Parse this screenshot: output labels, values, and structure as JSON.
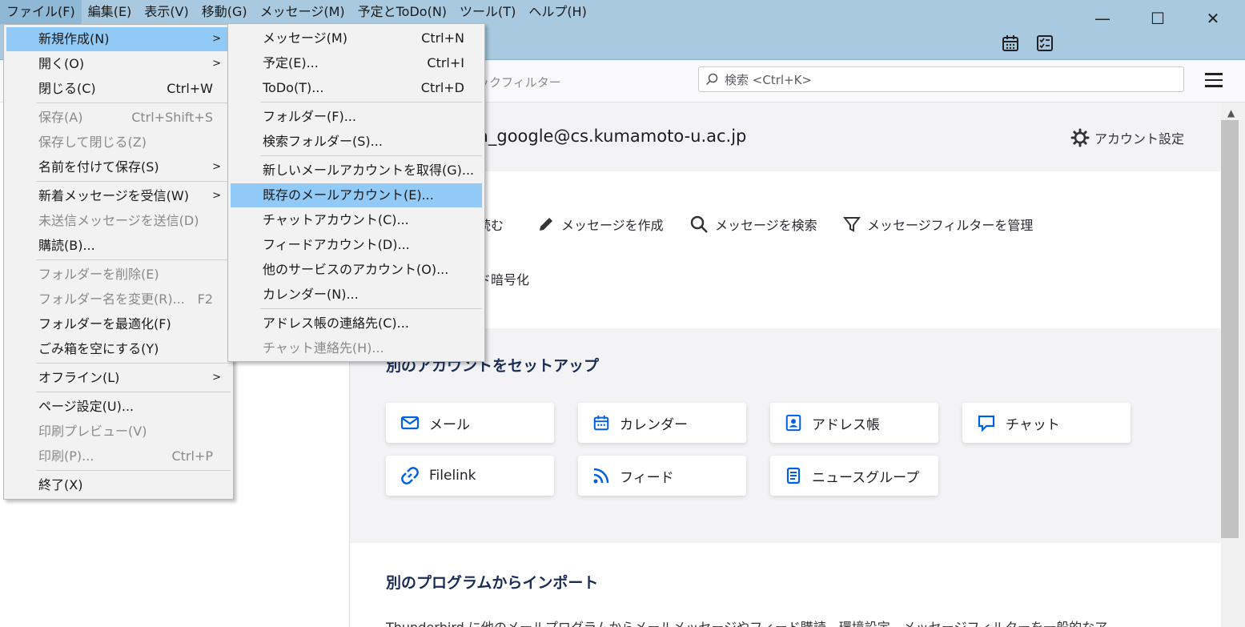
{
  "menubar": {
    "items": [
      "ファイル(F)",
      "編集(E)",
      "表示(V)",
      "移動(G)",
      "メッセージ(M)",
      "予定とToDo(N)",
      "ツール(T)",
      "ヘルプ(H)"
    ]
  },
  "window": {
    "minimize": "—",
    "maximize": "☐",
    "close": "✕"
  },
  "toolbar": {
    "quick_filter": "ックフィルター",
    "search_placeholder": "検索 <Ctrl+K>"
  },
  "account": {
    "email": "a_google@cs.kumamoto-u.ac.jp",
    "settings_label": "アカウント設定"
  },
  "actions": {
    "read": "読む",
    "compose": "メッセージを作成",
    "search": "メッセージを検索",
    "filters": "メッセージフィルターを管理",
    "e2e": "ド暗号化"
  },
  "setup": {
    "title": "別のアカウントをセットアップ",
    "buttons": [
      "メール",
      "カレンダー",
      "アドレス帳",
      "チャット",
      "Filelink",
      "フィード",
      "ニュースグループ"
    ]
  },
  "import": {
    "title": "別のプログラムからインポート",
    "description": "Thunderbird に他のメールプログラムからメールメッセージやフィード購読、環境設定、メッセージフィルターを一般的なア"
  },
  "file_menu": {
    "items": [
      {
        "label": "新規作成(N)",
        "shortcut": "",
        "submenu": true,
        "disabled": false,
        "highlighted": true
      },
      {
        "label": "開く(O)",
        "shortcut": "",
        "submenu": true,
        "disabled": false
      },
      {
        "label": "閉じる(C)",
        "shortcut": "Ctrl+W",
        "submenu": false,
        "disabled": false
      },
      {
        "label": "保存(A)",
        "shortcut": "Ctrl+Shift+S",
        "submenu": false,
        "disabled": true
      },
      {
        "label": "保存して閉じる(Z)",
        "shortcut": "",
        "submenu": false,
        "disabled": true
      },
      {
        "label": "名前を付けて保存(S)",
        "shortcut": "",
        "submenu": true,
        "disabled": false
      },
      {
        "label": "新着メッセージを受信(W)",
        "shortcut": "",
        "submenu": true,
        "disabled": false
      },
      {
        "label": "未送信メッセージを送信(D)",
        "shortcut": "",
        "submenu": false,
        "disabled": true
      },
      {
        "label": "購読(B)...",
        "shortcut": "",
        "submenu": false,
        "disabled": false
      },
      {
        "label": "フォルダーを削除(E)",
        "shortcut": "",
        "submenu": false,
        "disabled": true
      },
      {
        "label": "フォルダー名を変更(R)...",
        "shortcut": "F2",
        "submenu": false,
        "disabled": true
      },
      {
        "label": "フォルダーを最適化(F)",
        "shortcut": "",
        "submenu": false,
        "disabled": false
      },
      {
        "label": "ごみ箱を空にする(Y)",
        "shortcut": "",
        "submenu": false,
        "disabled": false
      },
      {
        "label": "オフライン(L)",
        "shortcut": "",
        "submenu": true,
        "disabled": false
      },
      {
        "label": "ページ設定(U)...",
        "shortcut": "",
        "submenu": false,
        "disabled": false
      },
      {
        "label": "印刷プレビュー(V)",
        "shortcut": "",
        "submenu": false,
        "disabled": true
      },
      {
        "label": "印刷(P)...",
        "shortcut": "Ctrl+P",
        "submenu": false,
        "disabled": true
      },
      {
        "label": "終了(X)",
        "shortcut": "",
        "submenu": false,
        "disabled": false
      }
    ]
  },
  "new_submenu": {
    "items": [
      {
        "label": "メッセージ(M)",
        "shortcut": "Ctrl+N",
        "disabled": false
      },
      {
        "label": "予定(E)...",
        "shortcut": "Ctrl+I",
        "disabled": false
      },
      {
        "label": "ToDo(T)...",
        "shortcut": "Ctrl+D",
        "disabled": false
      },
      {
        "label": "フォルダー(F)...",
        "shortcut": "",
        "disabled": false
      },
      {
        "label": "検索フォルダー(S)...",
        "shortcut": "",
        "disabled": false
      },
      {
        "label": "新しいメールアカウントを取得(G)...",
        "shortcut": "",
        "disabled": false
      },
      {
        "label": "既存のメールアカウント(E)...",
        "shortcut": "",
        "disabled": false,
        "highlighted": true
      },
      {
        "label": "チャットアカウント(C)...",
        "shortcut": "",
        "disabled": false
      },
      {
        "label": "フィードアカウント(D)...",
        "shortcut": "",
        "disabled": false
      },
      {
        "label": "他のサービスのアカウント(O)...",
        "shortcut": "",
        "disabled": false
      },
      {
        "label": "カレンダー(N)...",
        "shortcut": "",
        "disabled": false
      },
      {
        "label": "アドレス帳の連絡先(C)...",
        "shortcut": "",
        "disabled": false
      },
      {
        "label": "チャット連絡先(H)...",
        "shortcut": "",
        "disabled": true
      }
    ]
  },
  "colors": {
    "titlebar": "#a8c9df",
    "menu_highlight": "#91c9f7",
    "accent": "#0060df",
    "heading": "#1a2c55"
  }
}
